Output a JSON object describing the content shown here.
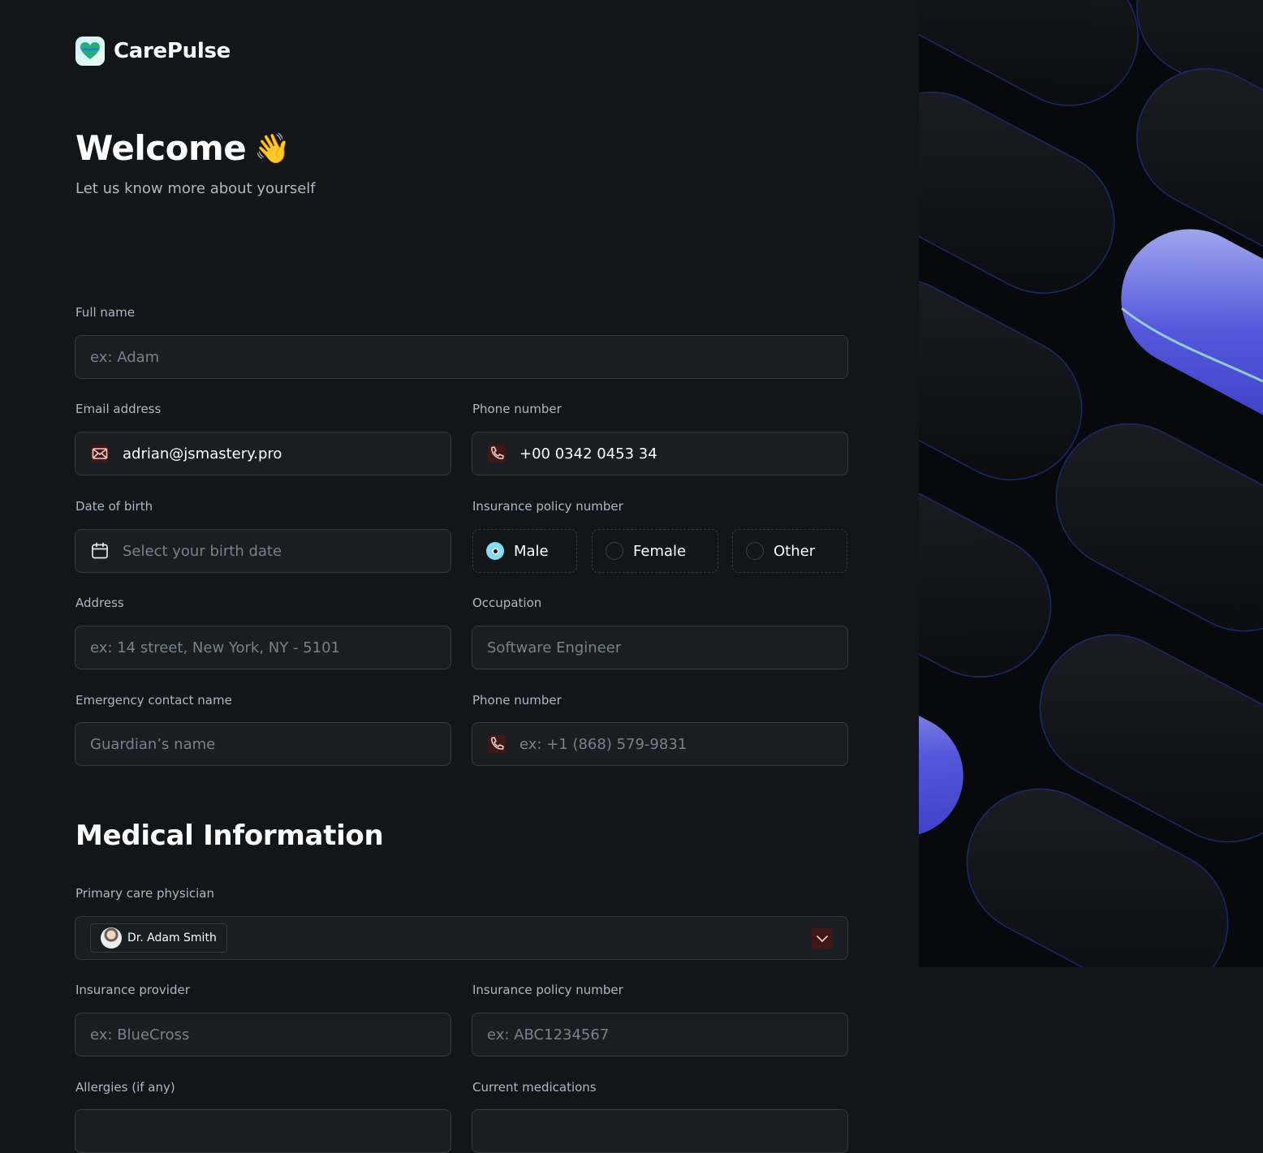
{
  "brand": {
    "name": "CarePulse"
  },
  "header": {
    "title": "Welcome",
    "emoji": "👋",
    "subtitle": "Let us know more about yourself"
  },
  "personal": {
    "full_name": {
      "label": "Full name",
      "placeholder": "ex: Adam"
    },
    "email": {
      "label": "Email address",
      "value": "adrian@jsmastery.pro"
    },
    "phone": {
      "label": "Phone number",
      "value": "+00 0342 0453 34"
    },
    "dob": {
      "label": "Date of birth",
      "placeholder": "Select your birth date"
    },
    "gender": {
      "label": "Insurance policy number",
      "options": [
        "Male",
        "Female",
        "Other"
      ],
      "selected": "Male"
    },
    "address": {
      "label": "Address",
      "placeholder": "ex: 14 street, New York, NY - 5101"
    },
    "occupation": {
      "label": "Occupation",
      "placeholder": "Software Engineer"
    },
    "emergency_name": {
      "label": "Emergency contact name",
      "placeholder": "Guardian’s name"
    },
    "emergency_phone": {
      "label": "Phone number",
      "placeholder": "ex: +1 (868) 579-9831"
    }
  },
  "medical": {
    "title": "Medical Information",
    "physician": {
      "label": "Primary care physician",
      "value": "Dr. Adam Smith"
    },
    "insurance_provider": {
      "label": "Insurance provider",
      "placeholder": "ex: BlueCross"
    },
    "insurance_policy": {
      "label": "Insurance policy number",
      "placeholder": "ex: ABC1234567"
    },
    "allergies": {
      "label": "Allergies (if any)"
    },
    "medications": {
      "label": "Current medications"
    }
  },
  "colors": {
    "background": "#131619",
    "field_bg": "#1A1D21",
    "border": "#363A3D",
    "label": "#ABB8C4",
    "accent_red": "#3E1716",
    "radio_selected": "#84DCF5"
  },
  "icons": [
    "carepulse-logo-icon",
    "wave-emoji",
    "email-icon",
    "phone-icon",
    "calendar-icon",
    "chevron-down-icon"
  ]
}
